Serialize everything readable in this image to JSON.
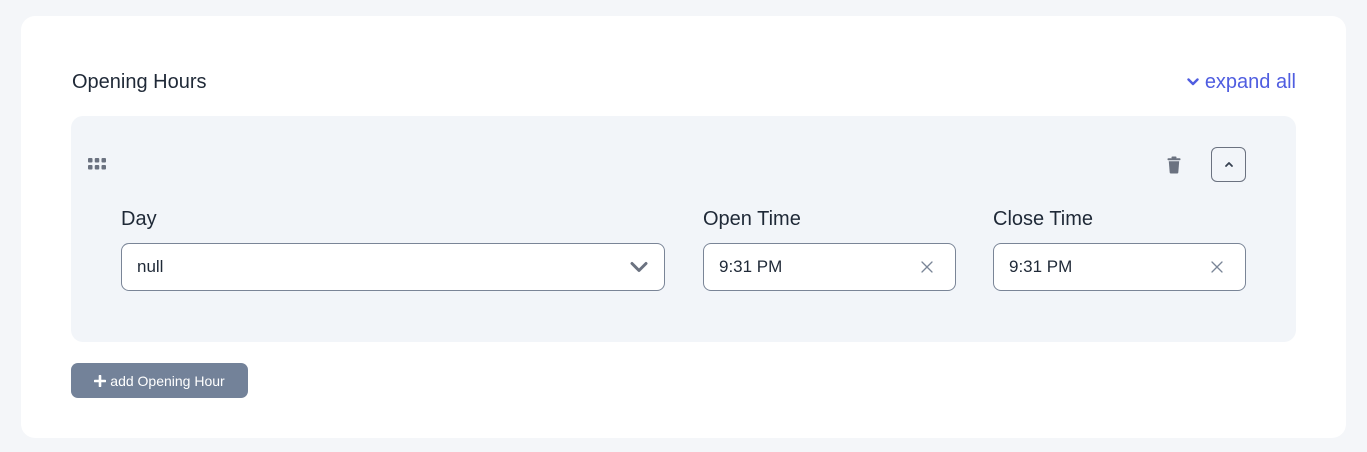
{
  "section": {
    "title": "Opening Hours",
    "expand_all_label": "expand all"
  },
  "opening_hour_row": {
    "day": {
      "label": "Day",
      "value": "null"
    },
    "open_time": {
      "label": "Open Time",
      "value": "9:31 PM"
    },
    "close_time": {
      "label": "Close Time",
      "value": "9:31 PM"
    }
  },
  "add_button": {
    "label": "add Opening Hour"
  },
  "icons": {
    "expand": "chevron-down-icon",
    "drag": "drag-handle-icon",
    "delete": "trash-icon",
    "collapse": "chevron-up-icon",
    "select": "chevron-down-icon",
    "clear": "close-icon",
    "add": "plus-icon"
  },
  "colors": {
    "page_background": "#f4f6f9",
    "card_background": "#ffffff",
    "panel_background": "#f2f5f9",
    "accent_link": "#4f5de0",
    "add_button_background": "#738299",
    "icon_gray": "#6b7280"
  }
}
